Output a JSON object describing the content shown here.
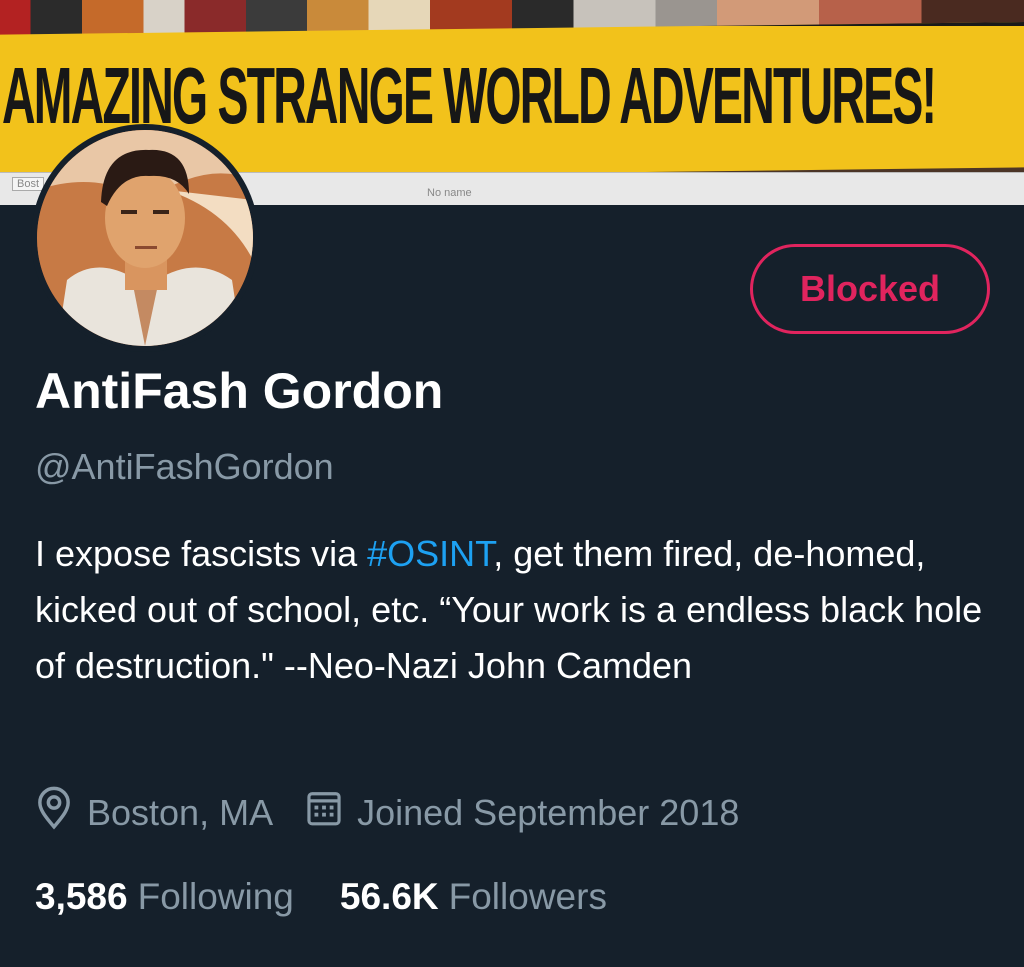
{
  "banner": {
    "title": "AMAZING STRANGE WORLD ADVENTURES!",
    "scrap_left": "Bost",
    "scrap_mid": "No name"
  },
  "profile": {
    "blocked_label": "Blocked",
    "display_name": "AntiFash Gordon",
    "handle": "@AntiFashGordon",
    "bio": {
      "before_hashtag": "I expose fascists via ",
      "hashtag": "#OSINT",
      "after_hashtag": ", get them fired, de-homed, kicked out of school, etc. “Your work is a endless black hole of destruction.\" --Neo-Nazi John Camden"
    },
    "location": "Boston, MA",
    "joined": "Joined September 2018",
    "following_count": "3,586",
    "following_label": "Following",
    "followers_count": "56.6K",
    "followers_label": "Followers"
  },
  "icons": {
    "location": "location-pin-icon",
    "joined": "calendar-icon"
  },
  "colors": {
    "background": "#15202b",
    "secondary_text": "#8899a6",
    "hashtag": "#1da1f2",
    "blocked": "#e0245e",
    "banner_yellow": "#f2c21b"
  }
}
